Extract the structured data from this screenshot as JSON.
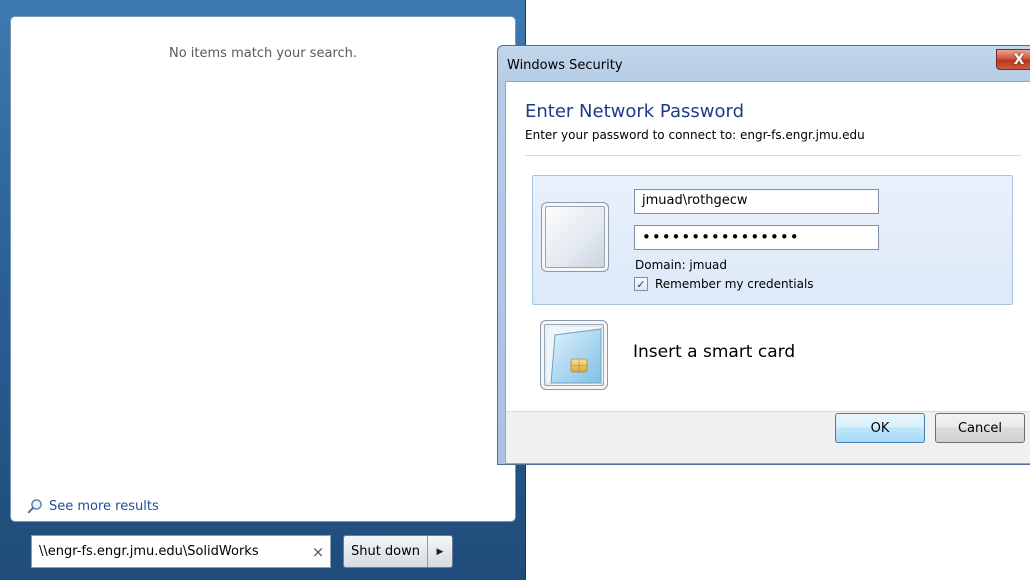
{
  "start_menu": {
    "no_results": "No items match your search.",
    "see_more": "See more results",
    "search_value": "\\\\engr-fs.engr.jmu.edu\\SolidWorks",
    "clear_glyph": "×",
    "shutdown_label": "Shut down",
    "shutdown_arrow": "▶"
  },
  "dialog": {
    "title": "Windows Security",
    "close_glyph": "X",
    "heading": "Enter Network Password",
    "subheading": "Enter your password to connect to: engr-fs.engr.jmu.edu",
    "username": "jmuad\\rothgecw",
    "password_mask": "••••••••••••••••",
    "domain": "Domain: jmuad",
    "remember_label": "Remember my credentials",
    "remember_checked": true,
    "check_glyph": "✓",
    "smart_card_label": "Insert a smart card",
    "ok_label": "OK",
    "cancel_label": "Cancel"
  },
  "colors": {
    "taskbar_blue": "#2f6aa0",
    "heading_blue": "#1e3b8a",
    "close_red": "#c9452b",
    "selected_tile": "#dde9f8"
  },
  "icons": [
    "search-icon",
    "clear-icon",
    "arrow-right-icon",
    "close-icon",
    "user-picture-icon",
    "smart-card-icon",
    "checkbox-checked-icon"
  ]
}
